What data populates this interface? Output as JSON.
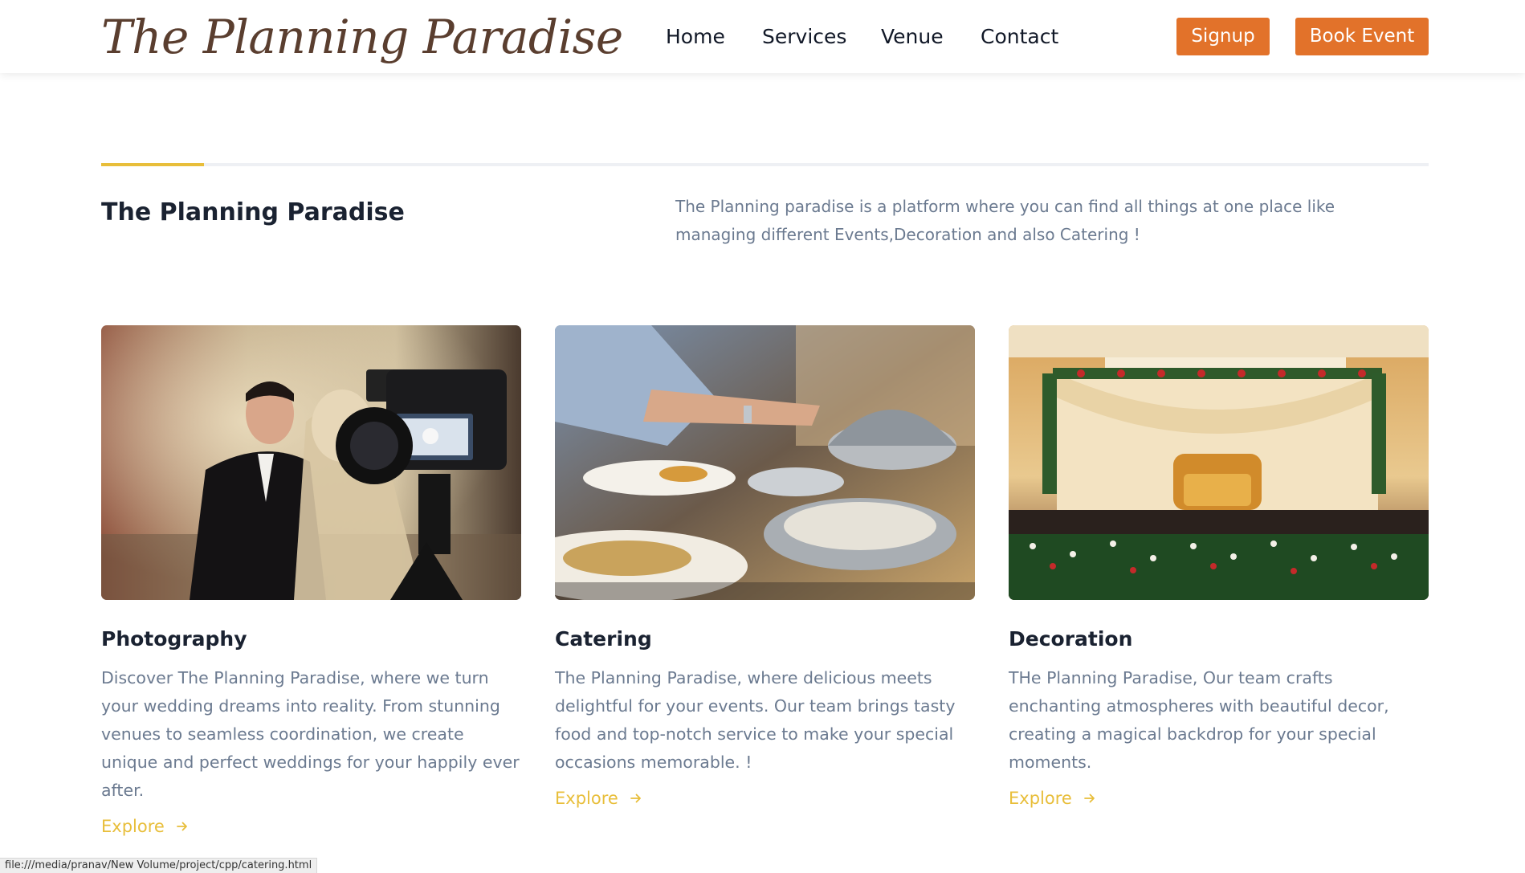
{
  "header": {
    "logo": "The Planning Paradise",
    "nav": [
      "Home",
      "Services",
      "Venue",
      "Contact"
    ],
    "signup_label": "Signup",
    "book_label": "Book Event"
  },
  "intro": {
    "title": "The Planning Paradise",
    "text": "The Planning paradise is a platform where you can find all things at one place like managing different Events,Decoration and also Catering !"
  },
  "cards": [
    {
      "title": "Photography",
      "text": "Discover The Planning Paradise, where we turn your wedding dreams into reality. From stunning venues to seamless coordination, we create unique and perfect weddings for your happily ever after.",
      "link": "Explore",
      "image": "wedding-photography-camera"
    },
    {
      "title": "Catering",
      "text": "The Planning Paradise, where delicious meets delightful for your events. Our team brings tasty food and top-notch service to make your special occasions memorable. !",
      "link": "Explore",
      "image": "catering-buffet"
    },
    {
      "title": "Decoration",
      "text": "THe Planning Paradise, Our team crafts enchanting atmospheres with beautiful decor, creating a magical backdrop for your special moments.",
      "link": "Explore",
      "image": "decorated-stage"
    }
  ],
  "status_bar": "file:///media/pranav/New Volume/project/cpp/catering.html",
  "colors": {
    "brand_orange": "#e2722a",
    "accent_yellow": "#e8be3a",
    "logo_brown": "#5a3e2f",
    "body_text": "#6b7a90"
  }
}
